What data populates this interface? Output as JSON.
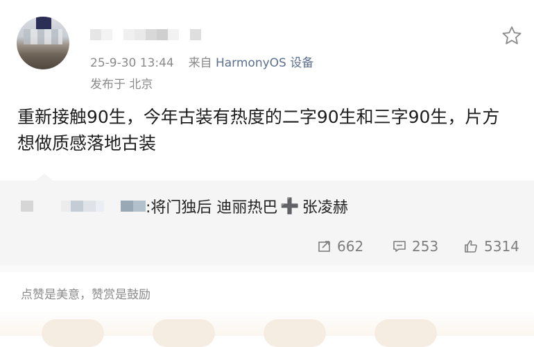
{
  "post": {
    "timestamp": "25-9-30 13:44",
    "source_prefix": "来自",
    "source_device": "HarmonyOS 设备",
    "location": "发布于 北京",
    "content": "重新接触90生，今年古装有热度的二字90生和三字90生，片方想做质感落地古装"
  },
  "quote": {
    "text_after_mosaic": ":将门独后  迪丽热巴",
    "plus": "➕",
    "text_end": "张凌赫"
  },
  "actions": {
    "repost_count": "662",
    "comment_count": "253",
    "like_count": "5314"
  },
  "footer": {
    "tip": "点赞是美意，赞赏是鼓励"
  },
  "icons": {
    "favorite": "star-icon",
    "repost": "repost-icon",
    "comment": "comment-icon",
    "like": "thumbs-up-icon"
  },
  "colors": {
    "source_link": "#5a6f8e",
    "secondary_text": "#8a8a8a",
    "quote_bg": "#f5f5f5"
  }
}
